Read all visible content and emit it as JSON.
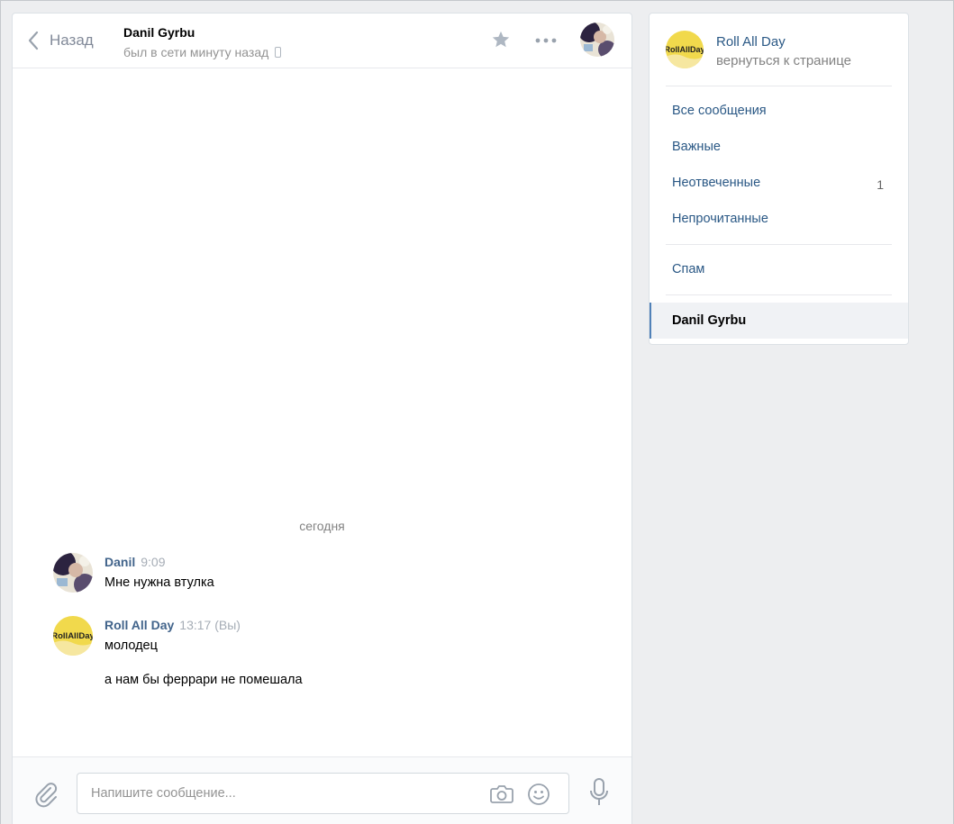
{
  "header": {
    "back_label": "Назад",
    "peer_name": "Danil Gyrbu",
    "peer_status": "был в сети минуту назад"
  },
  "chat": {
    "date_separator": "сегодня",
    "messages": [
      {
        "author": "Danil",
        "time": "9:09",
        "text": "Мне нужна втулка"
      },
      {
        "author": "Roll All Day",
        "time": "13:17 (Вы)",
        "text": "молодец",
        "text2": "а нам бы феррари не помешала"
      }
    ]
  },
  "composer": {
    "placeholder": "Напишите сообщение..."
  },
  "sidebar": {
    "group_name": "Roll All Day",
    "group_logo_text": "RollAllDay",
    "group_back": "вернуться к странице",
    "items": [
      {
        "label": "Все сообщения"
      },
      {
        "label": "Важные"
      },
      {
        "label": "Неотвеченные",
        "count": "1"
      },
      {
        "label": "Непрочитанные"
      },
      {
        "label": "Спам"
      },
      {
        "label": "Danil Gyrbu"
      }
    ]
  },
  "colors": {
    "link": "#2a5885",
    "author": "#42648b",
    "accent": "#5181b8",
    "logo_yellow": "#f1d94c"
  }
}
